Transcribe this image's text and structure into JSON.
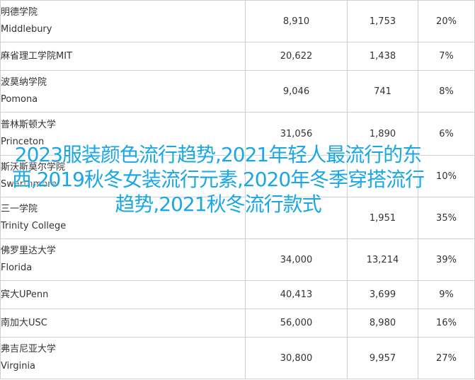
{
  "colors": {
    "grid": "#cfcfcf",
    "text": "#333333",
    "overlay": "#1aa7e6"
  },
  "rows": [
    {
      "cn": "明德学院",
      "en": "Middlebury",
      "a": "8,910",
      "b": "1,753",
      "c": "20%"
    },
    {
      "cn": "麻省理工学院MIT",
      "en": "",
      "a": "20,622",
      "b": "1,438",
      "c": "7%"
    },
    {
      "cn": "波莫纳学院",
      "en": "Pomona",
      "a": "9,046",
      "b": "741",
      "c": "8%"
    },
    {
      "cn": "普林斯顿大学",
      "en": "Princeton",
      "a": "31,056",
      "b": "1,890",
      "c": "6%"
    },
    {
      "cn": "斯沃斯莫尔学院",
      "en": "Swarthmore",
      "a": "",
      "b": "",
      "c": "10%"
    },
    {
      "cn": "三一学院",
      "en": "Trinity College",
      "a": "",
      "b": "1,951",
      "c": "35%"
    },
    {
      "cn": "佛罗里达大学",
      "en": "Florida",
      "a": "34,000",
      "b": "13,214",
      "c": "39%"
    },
    {
      "cn": "宾大UPenn",
      "en": "",
      "a": "40,413",
      "b": "3,699",
      "c": "9%"
    },
    {
      "cn": "南加大USC",
      "en": "",
      "a": "56,000",
      "b": "8,980",
      "c": "16%"
    },
    {
      "cn": "弗吉尼亚大学",
      "en": "Virginia",
      "a": "30,800",
      "b": "9,957",
      "c": "27%"
    }
  ],
  "overlay": {
    "text": "2023服装颜色流行趋势,2021年轻人最流行的东西,2019秋冬女装流行元素,2020年冬季穿搭流行趋势,2021秋冬流行款式"
  }
}
